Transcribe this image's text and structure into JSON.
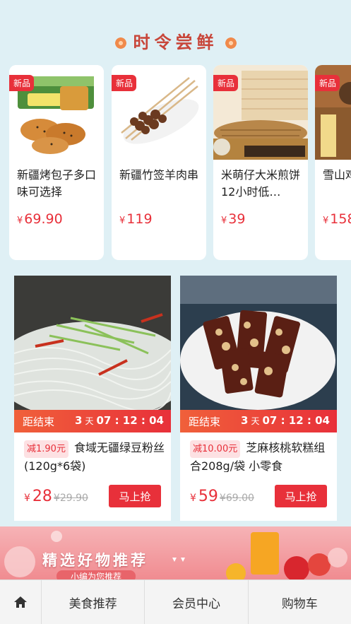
{
  "section": {
    "title": "时令尝鲜"
  },
  "seasonal": [
    {
      "badge": "新品",
      "name": "新疆烤包子多口味可选择",
      "currency": "¥",
      "price": "69.90"
    },
    {
      "badge": "新品",
      "name": "新疆竹签羊肉串",
      "currency": "¥",
      "price": "119"
    },
    {
      "badge": "新品",
      "name": "米萌仔大米煎饼 12小时低…",
      "currency": "¥",
      "price": "39"
    },
    {
      "badge": "新品",
      "name": "雪山鸡母鸡",
      "currency": "¥",
      "price": "158"
    }
  ],
  "deals": [
    {
      "countdown_label": "距结束",
      "days": "3",
      "days_unit": "天",
      "time": "07 : 12 : 04",
      "discount": "减1.90元",
      "name": "食域无疆绿豆粉丝(120g*6袋)",
      "currency": "¥",
      "price": "28",
      "old_price": "29.90",
      "button": "马上抢"
    },
    {
      "countdown_label": "距结束",
      "days": "3",
      "days_unit": "天",
      "time": "07 : 12 : 04",
      "discount": "减10.00元",
      "name": "芝麻核桃软糕组合208g/袋 小零食",
      "currency": "¥",
      "price": "59",
      "old_price": "69.00",
      "button": "马上抢"
    }
  ],
  "banner": {
    "title": "精选好物推荐",
    "subtitle": "小编为您推荐"
  },
  "tabbar": {
    "home_icon": "home-icon",
    "tabs": [
      "美食推荐",
      "会员中心",
      "购物车"
    ]
  },
  "colors": {
    "accent": "#e8303a",
    "background": "#dff0f5"
  }
}
